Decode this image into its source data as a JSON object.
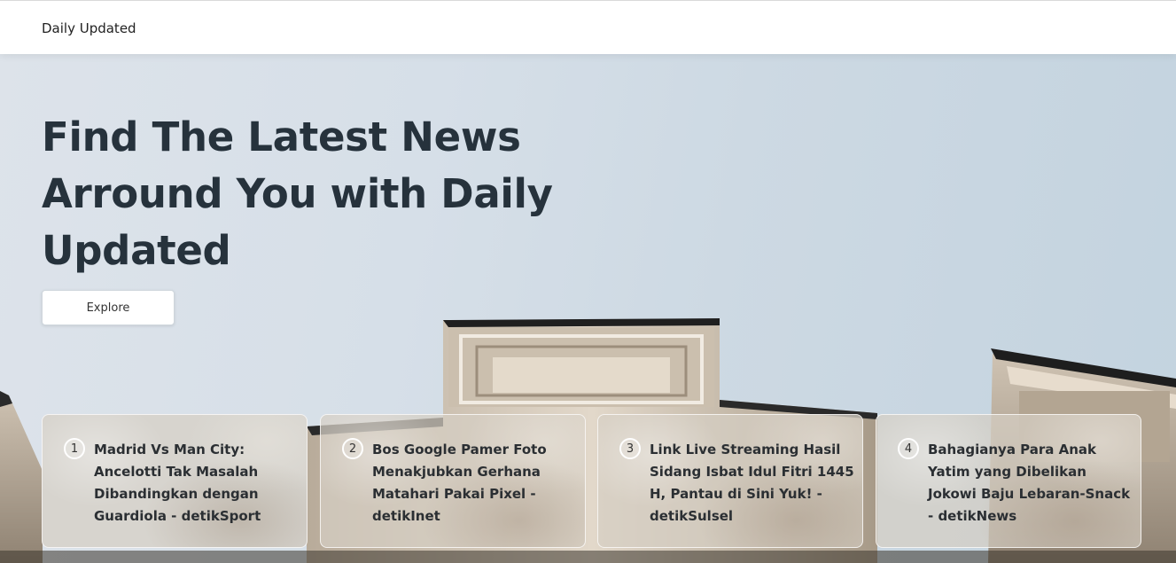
{
  "navbar": {
    "brand": "Daily Updated"
  },
  "hero": {
    "headline": "Find The Latest News Arround You with Daily Updated",
    "explore_label": "Explore"
  },
  "news": [
    {
      "number": "1",
      "title": "Madrid Vs Man City: Ancelotti Tak Masalah Dibandingkan dengan Guardiola - detikSport"
    },
    {
      "number": "2",
      "title": "Bos Google Pamer Foto Menakjubkan Gerhana Matahari Pakai Pixel - detikInet"
    },
    {
      "number": "3",
      "title": "Link Live Streaming Hasil Sidang Isbat Idul Fitri 1445 H, Pantau di Sini Yuk! - detikSulsel"
    },
    {
      "number": "4",
      "title": "Bahagianya Para Anak Yatim yang Dibelikan Jokowi Baju Lebaran-Snack - detikNews"
    }
  ]
}
